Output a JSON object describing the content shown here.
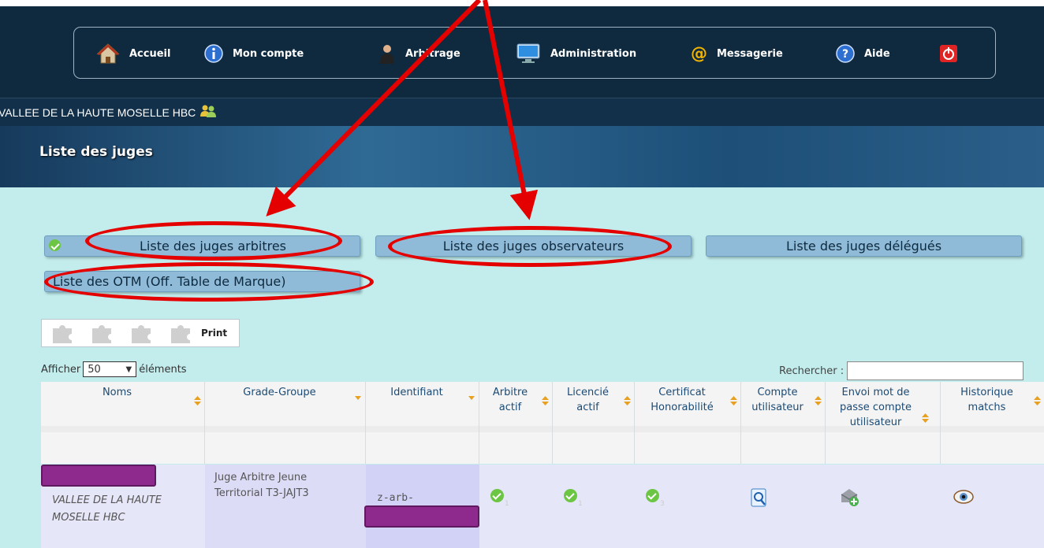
{
  "nav": {
    "accueil": "Accueil",
    "mon_compte": "Mon compte",
    "arbitrage": "Arbitrage",
    "administration": "Administration",
    "messagerie": "Messagerie",
    "aide": "Aide"
  },
  "club_name": "VALLEE DE LA HAUTE MOSELLE HBC",
  "page_title": "Liste des juges",
  "buttons": {
    "arbitres": "Liste des juges arbitres",
    "observateurs": "Liste des juges observateurs",
    "delegues": "Liste des juges délégués",
    "otm": "Liste des OTM (Off. Table de Marque)"
  },
  "toolbar": {
    "print": "Print"
  },
  "table_controls": {
    "show_prefix": "Afficher",
    "page_size": "50",
    "show_suffix": "éléments",
    "search_label": "Rechercher :"
  },
  "table": {
    "headers": {
      "noms": "Noms",
      "grade": "Grade-Groupe",
      "identifiant": "Identifiant",
      "arbitre_actif": "Arbitre actif",
      "licencie_actif": "Licencié actif",
      "certificat": "Certificat Honorabilité",
      "compte": "Compte utilisateur",
      "envoi": "Envoi mot de passe compte utilisateur",
      "historique": "Historique matchs"
    },
    "row": {
      "club": "VALLEE DE LA HAUTE MOSELLE HBC",
      "grade": "Juge Arbitre Jeune Territorial T3-JAJT3",
      "identifiant": "z-arb-",
      "arbitre_actif_sub": "1",
      "licencie_actif_sub": "1",
      "certificat_sub": "3"
    }
  },
  "colors": {
    "annotation": "#e50000",
    "redaction": "#8e2a8e",
    "content_bg": "#c3eded"
  }
}
